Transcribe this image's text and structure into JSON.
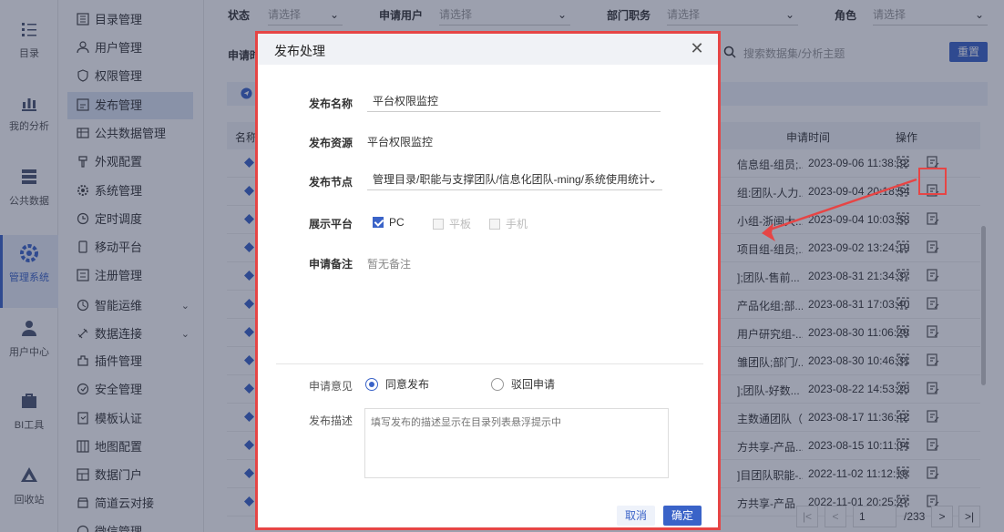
{
  "rail": [
    {
      "label": "目录",
      "icon": "catalog-icon"
    },
    {
      "label": "我的分析",
      "icon": "analysis-icon"
    },
    {
      "label": "公共数据",
      "icon": "public-data-icon"
    },
    {
      "label": "管理系统",
      "icon": "admin-system-icon",
      "active": true
    },
    {
      "label": "用户中心",
      "icon": "user-center-icon"
    },
    {
      "label": "BI工具",
      "icon": "bi-tool-icon"
    },
    {
      "label": "回收站",
      "icon": "recycle-bin-icon"
    }
  ],
  "menu": [
    {
      "label": "目录管理",
      "icon": "directory-icon"
    },
    {
      "label": "用户管理",
      "icon": "user-icon"
    },
    {
      "label": "权限管理",
      "icon": "shield-icon"
    },
    {
      "label": "发布管理",
      "icon": "publish-icon",
      "active": true
    },
    {
      "label": "公共数据管理",
      "icon": "database-icon"
    },
    {
      "label": "外观配置",
      "icon": "appearance-icon"
    },
    {
      "label": "系统管理",
      "icon": "gear-icon"
    },
    {
      "label": "定时调度",
      "icon": "clock-icon"
    },
    {
      "label": "移动平台",
      "icon": "mobile-icon"
    },
    {
      "label": "注册管理",
      "icon": "register-icon"
    },
    {
      "label": "智能运维",
      "icon": "ops-icon",
      "expand": true
    },
    {
      "label": "数据连接",
      "icon": "link-icon",
      "expand": true
    },
    {
      "label": "插件管理",
      "icon": "plugin-icon"
    },
    {
      "label": "安全管理",
      "icon": "lock-icon"
    },
    {
      "label": "模板认证",
      "icon": "template-icon"
    },
    {
      "label": "地图配置",
      "icon": "map-icon"
    },
    {
      "label": "数据门户",
      "icon": "portal-icon"
    },
    {
      "label": "简道云对接",
      "icon": "cloud-icon"
    },
    {
      "label": "微信管理",
      "icon": "wechat-icon"
    }
  ],
  "filters": {
    "status_label": "状态",
    "status_placeholder": "请选择",
    "user_label": "申请用户",
    "user_placeholder": "请选择",
    "dept_label": "部门职务",
    "dept_placeholder": "请选择",
    "role_label": "角色",
    "role_placeholder": "请选择",
    "time_label": "申请时",
    "search_placeholder": "搜索数据集/分析主题",
    "reset_label": "重置"
  },
  "table": {
    "col_name": "名称",
    "col_time": "申请时间",
    "col_ops": "操作",
    "rows": [
      {
        "name": "信息组-组员;...",
        "time": "2023-09-06 11:38:32"
      },
      {
        "name": "组:团队-人力...",
        "time": "2023-09-04 20:18:54"
      },
      {
        "name": "小组-浙闽大...",
        "time": "2023-09-04 10:03:53"
      },
      {
        "name": "项目组-组员;...",
        "time": "2023-09-02 13:24:19"
      },
      {
        "name": "];团队-售前...",
        "time": "2023-08-31 21:34:37"
      },
      {
        "name": "产品化组;部...",
        "time": "2023-08-31 17:03:40"
      },
      {
        "name": "用户研究组-...",
        "time": "2023-08-30 11:06:29"
      },
      {
        "name": "雏团队;部门/...",
        "time": "2023-08-30 10:46:31"
      },
      {
        "name": "];团队-好数...",
        "time": "2023-08-22 14:53:25"
      },
      {
        "name": "主数通团队（...",
        "time": "2023-08-17 11:36:42"
      },
      {
        "name": "方共享-产品...",
        "time": "2023-08-15 10:11:04"
      },
      {
        "name": "]目团队职能-...",
        "time": "2022-11-02 11:12:19"
      },
      {
        "name": "方共享-产品...",
        "time": "2022-11-01 20:25:27"
      }
    ]
  },
  "pager": {
    "page": "1",
    "total": "/233"
  },
  "modal": {
    "title": "发布处理",
    "name_label": "发布名称",
    "name_value": "平台权限监控",
    "resource_label": "发布资源",
    "resource_value": "平台权限监控",
    "node_label": "发布节点",
    "node_value": "管理目录/职能与支撑团队/信息化团队-ming/系统使用统计",
    "platform_label": "展示平台",
    "platforms": [
      {
        "label": "PC",
        "checked": true
      },
      {
        "label": "平板",
        "disabled": true
      },
      {
        "label": "手机",
        "disabled": true
      }
    ],
    "remark_label": "申请备注",
    "remark_value": "暂无备注",
    "opinion_label": "申请意见",
    "approve_label": "同意发布",
    "reject_label": "驳回申请",
    "desc_label": "发布描述",
    "desc_placeholder": "填写发布的描述显示在目录列表悬浮提示中",
    "cancel_label": "取消",
    "ok_label": "确定"
  },
  "colors": {
    "primary": "#3a63c8",
    "highlight": "#e64545"
  }
}
